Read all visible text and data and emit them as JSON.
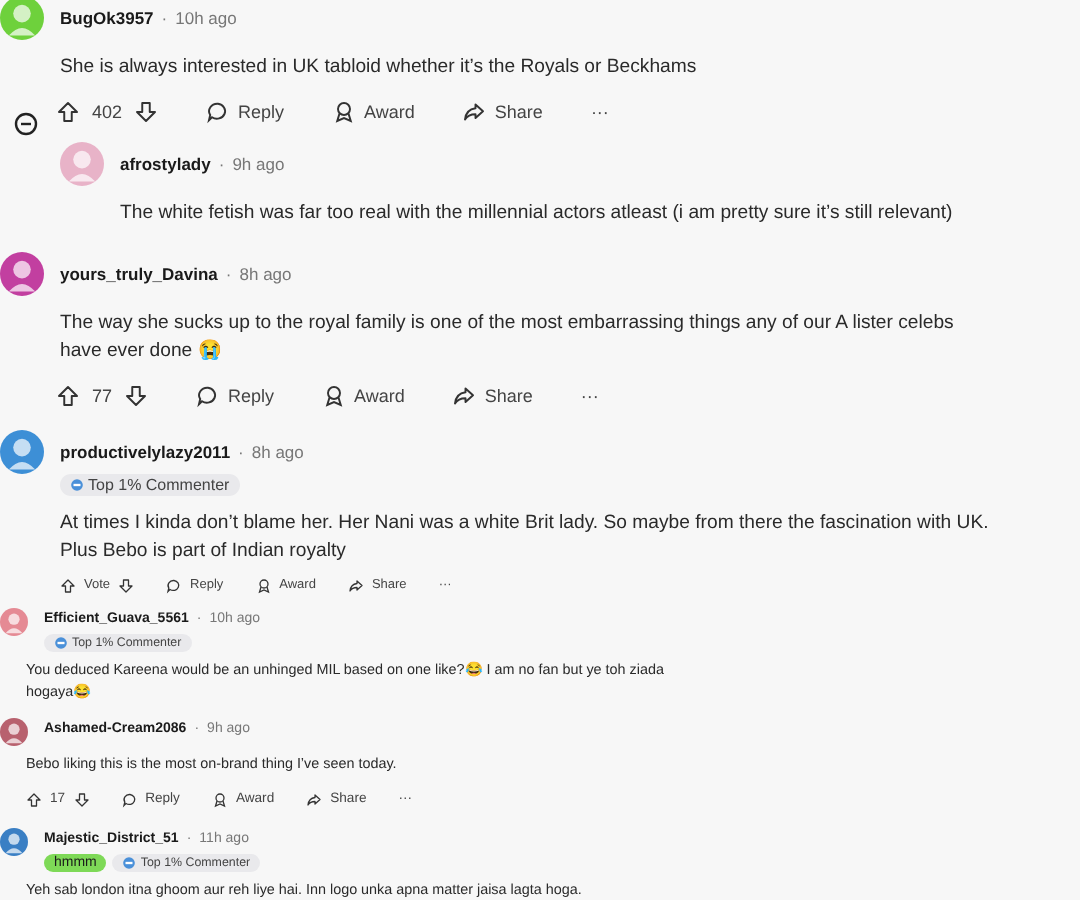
{
  "comments": [
    {
      "kind": "full",
      "username": "BugOk3957",
      "dot": "·",
      "time": "10h ago",
      "color": "#6ed13c",
      "collapsible": true,
      "body": "She is always interested in UK tabloid whether it’s the Royals or Beckhams",
      "actions": {
        "votes": "402",
        "reply": "Reply",
        "award": "Award",
        "share": "Share",
        "more": "···"
      },
      "children": [
        {
          "username": "afrostylady",
          "dot": "·",
          "time": "9h ago",
          "color": "#e8b3c8",
          "body": "The white fetish was far too real with the millennial actors atleast (i am pretty sure it’s still relevant)"
        }
      ]
    },
    {
      "kind": "full",
      "username": "yours_truly_Davina",
      "dot": "·",
      "time": "8h ago",
      "color": "#c23fa0",
      "body": "The way she sucks up to the royal family is one of the most embarrassing things any of our A lister celebs have ever done 😭",
      "actions": {
        "votes": "77",
        "reply": "Reply",
        "award": "Award",
        "share": "Share",
        "more": "···"
      }
    },
    {
      "kind": "full",
      "username": "productivelylazy2011",
      "dot": "·",
      "time": "8h ago",
      "color": "#3d8fd6",
      "flairs": [
        {
          "text": "Top 1% Commenter",
          "kind": "badge"
        }
      ],
      "body": "At times I kinda don’t blame her. Her Nani was a white Brit lady. So maybe from there the fascination with UK. Plus Bebo is part of Indian royalty",
      "actions": {
        "kind": "compact",
        "votes": "Vote",
        "reply": "Reply",
        "award": "Award",
        "share": "Share",
        "more": "···"
      }
    },
    {
      "kind": "compact",
      "username": "Efficient_Guava_5561",
      "dot": "·",
      "time": "10h ago",
      "color": "#e58a94",
      "flairs": [
        {
          "text": "Top 1% Commenter",
          "kind": "badge"
        }
      ],
      "body": "You deduced Kareena would be an unhinged MIL based on one like?😂 I am no fan but ye toh ziada hogaya😂"
    },
    {
      "kind": "compact",
      "username": "Ashamed-Cream2086",
      "dot": "·",
      "time": "9h ago",
      "color": "#b8616e",
      "body": "Bebo liking this is the most on-brand thing I’ve seen today.",
      "actions": {
        "votes": "17",
        "reply": "Reply",
        "award": "Award",
        "share": "Share",
        "more": "···"
      }
    },
    {
      "kind": "compact",
      "username": "Majestic_District_51",
      "dot": "·",
      "time": "11h ago",
      "color": "#3a7fc4",
      "flairs": [
        {
          "text": "hmmm",
          "kind": "tag",
          "color": "#7ed957"
        },
        {
          "text": "Top 1% Commenter",
          "kind": "badge"
        }
      ],
      "body": "Yeh sab london itna ghoom aur reh liye hai. Inn logo unka apna matter jaisa lagta hoga."
    }
  ]
}
